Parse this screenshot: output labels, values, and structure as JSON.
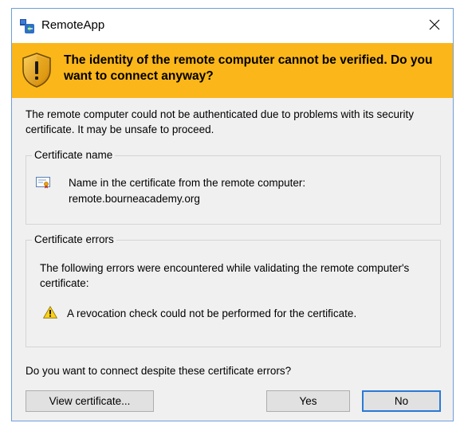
{
  "window": {
    "title": "RemoteApp"
  },
  "banner": {
    "message": "The identity of the remote computer cannot be verified. Do you want to connect anyway?"
  },
  "body": {
    "description": "The remote computer could not be authenticated due to problems with its security certificate. It may be unsafe to proceed."
  },
  "certificate_name": {
    "legend": "Certificate name",
    "label": "Name in the certificate from the remote computer:",
    "value": "remote.bourneacademy.org"
  },
  "certificate_errors": {
    "legend": "Certificate errors",
    "intro": "The following errors were encountered while validating the remote computer's certificate:",
    "items": [
      "A revocation check could not be performed for the certificate."
    ]
  },
  "question": "Do you want to connect despite these certificate errors?",
  "buttons": {
    "view_certificate": "View certificate...",
    "yes": "Yes",
    "no": "No"
  },
  "colors": {
    "banner": "#fbb61a",
    "window_bg": "#f0f0f0",
    "default_button_border": "#2a7ad6"
  }
}
